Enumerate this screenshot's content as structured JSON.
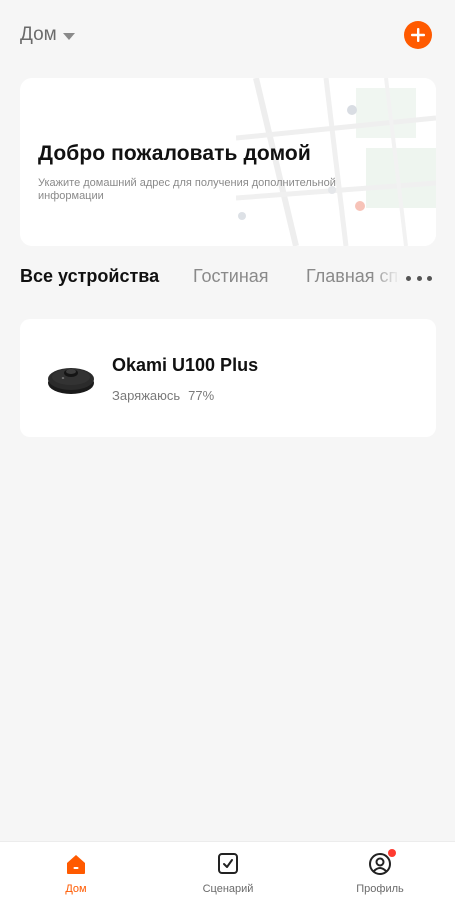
{
  "header": {
    "home_label": "Дом",
    "add_icon": "plus-circle-icon"
  },
  "welcome": {
    "title": "Добро пожаловать домой",
    "subtitle": "Укажите домашний адрес для получения дополнительной информации"
  },
  "tabs": [
    {
      "label": "Все устройства",
      "active": true
    },
    {
      "label": "Гостиная",
      "active": false
    },
    {
      "label": "Главная спальня",
      "active": false
    }
  ],
  "devices": [
    {
      "name": "Okami U100 Plus",
      "status": "Заряжаюсь",
      "battery": "77%",
      "icon": "robot-vacuum-icon"
    }
  ],
  "bottom_nav": [
    {
      "label": "Дом",
      "icon": "home-icon",
      "active": true
    },
    {
      "label": "Сценарий",
      "icon": "checkbox-icon",
      "active": false
    },
    {
      "label": "Профиль",
      "icon": "profile-icon",
      "active": false,
      "badge": true
    }
  ],
  "colors": {
    "accent": "#ff5a00",
    "background": "#f6f6f6",
    "card": "#ffffff",
    "badge": "#ff3b30"
  }
}
